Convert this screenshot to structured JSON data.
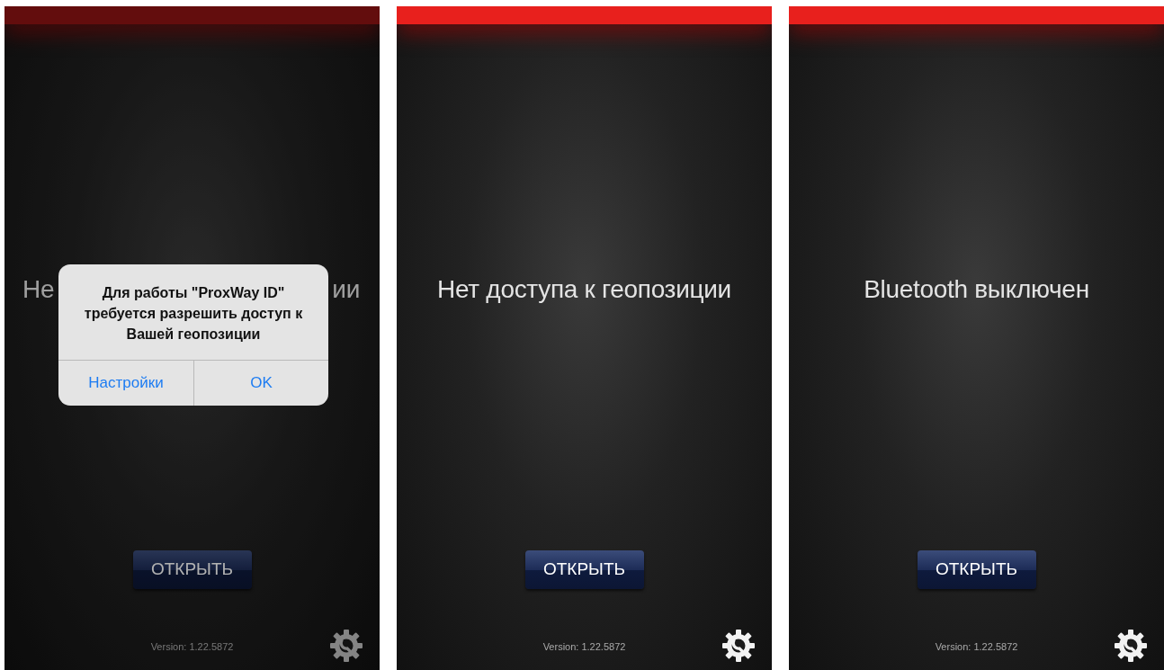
{
  "screens": [
    {
      "dimmed": true,
      "message_fragments": [
        "Не",
        "ии"
      ],
      "alert": {
        "text": "Для работы \"ProxWay ID\" требуется разрешить доступ к Вашей геопозиции",
        "buttons": [
          {
            "label": "Настройки"
          },
          {
            "label": "OK"
          }
        ]
      },
      "open_button": "ОТКРЫТЬ",
      "version": "Version: 1.22.5872"
    },
    {
      "dimmed": false,
      "message": "Нет доступа к геопозиции",
      "open_button": "ОТКРЫТЬ",
      "version": "Version: 1.22.5872"
    },
    {
      "dimmed": false,
      "message": "Bluetooth выключен",
      "open_button": "ОТКРЫТЬ",
      "version": "Version: 1.22.5872"
    }
  ]
}
